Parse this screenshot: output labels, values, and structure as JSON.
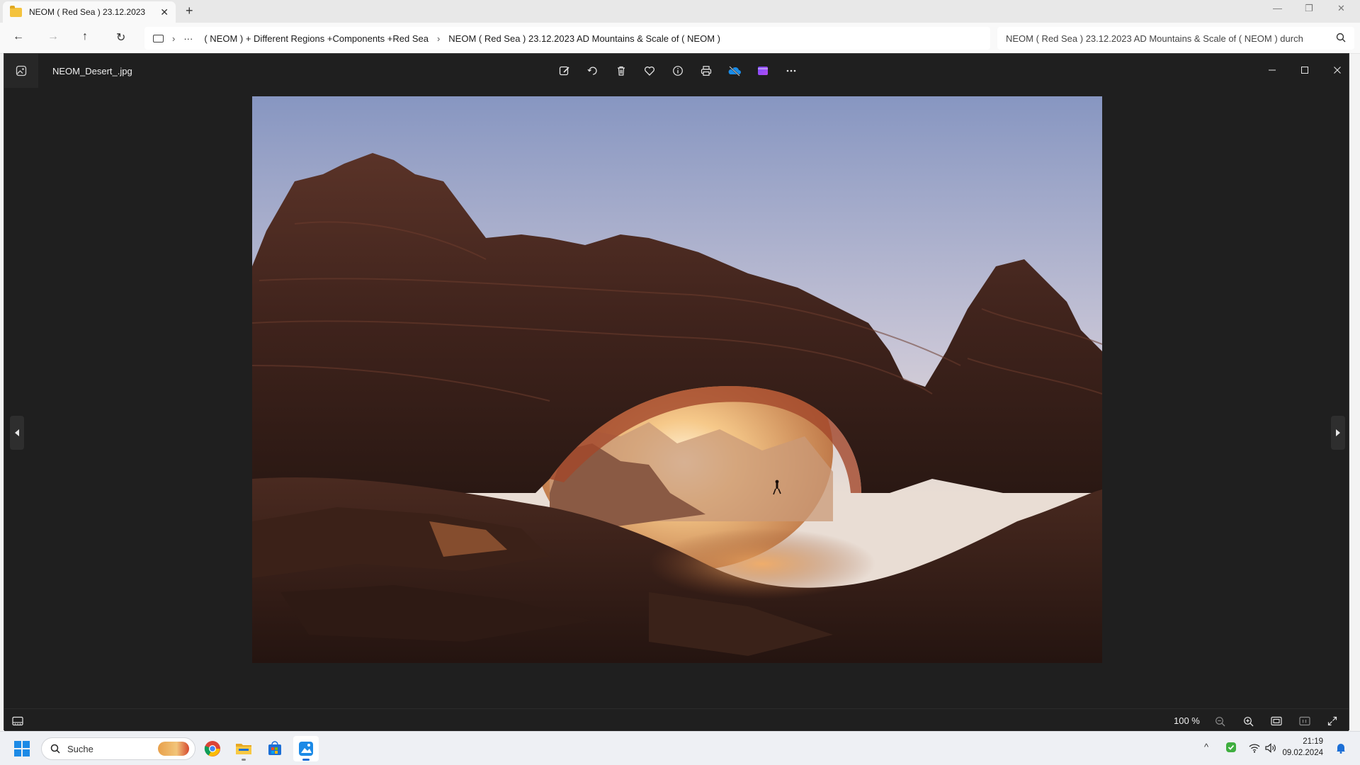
{
  "explorer": {
    "tab_title": "NEOM ( Red Sea )  23.12.2023",
    "tab_close": "✕",
    "new_tab": "+",
    "window_controls": {
      "minimize": "—",
      "restore": "❐",
      "close": "✕"
    },
    "nav": {
      "back": "←",
      "forward": "→",
      "up": "↑",
      "refresh": "↻"
    },
    "address": {
      "more": "···",
      "breadcrumbs": [
        "( NEOM ) + Different Regions +Components +Red Sea",
        "NEOM ( Red Sea )  23.12.2023 AD Mountains & Scale of ( NEOM )"
      ]
    },
    "search_placeholder": "NEOM ( Red Sea )  23.12.2023 AD Mountains & Scale of ( NEOM ) durch"
  },
  "photos": {
    "file_name": "NEOM_Desert_.jpg",
    "toolbar": [
      "edit-image",
      "rotate",
      "delete",
      "favorite",
      "file-info",
      "print",
      "onedrive",
      "clipchamp",
      "more"
    ],
    "status": {
      "zoom_level": "100 %"
    },
    "colors": {
      "background": "#1f1f1f",
      "sky_top": "#8e9dc4",
      "sky_bottom": "#e6ddd6",
      "rock": "#4a2a22"
    }
  },
  "taskbar": {
    "search_label": "Suche",
    "apps": [
      "chrome",
      "file-explorer",
      "microsoft-store",
      "photos"
    ],
    "clock": {
      "time": "21:19",
      "date": "09.02.2024"
    },
    "tray": {
      "chevron": "^"
    }
  }
}
